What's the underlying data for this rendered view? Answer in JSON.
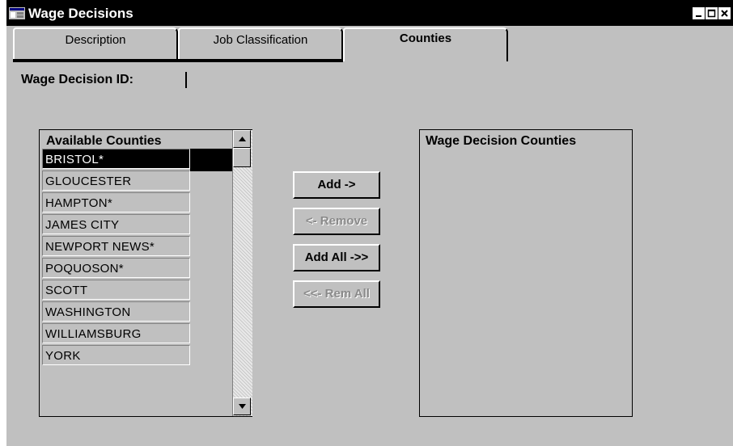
{
  "window": {
    "title": "Wage Decisions"
  },
  "tabs": [
    {
      "label": "Description",
      "active": false
    },
    {
      "label": "Job Classification",
      "active": false
    },
    {
      "label": "Counties",
      "active": true
    }
  ],
  "form": {
    "wage_decision_id_label": "Wage Decision ID:",
    "wage_decision_id_value": ""
  },
  "available_counties": {
    "header": "Available Counties",
    "items": [
      {
        "label": "BRISTOL*",
        "selected": true
      },
      {
        "label": "GLOUCESTER",
        "selected": false
      },
      {
        "label": "HAMPTON*",
        "selected": false
      },
      {
        "label": "JAMES CITY",
        "selected": false
      },
      {
        "label": "NEWPORT NEWS*",
        "selected": false
      },
      {
        "label": "POQUOSON*",
        "selected": false
      },
      {
        "label": "SCOTT",
        "selected": false
      },
      {
        "label": "WASHINGTON",
        "selected": false
      },
      {
        "label": "WILLIAMSBURG",
        "selected": false
      },
      {
        "label": "YORK",
        "selected": false
      }
    ]
  },
  "actions": {
    "add": {
      "label": "Add ->",
      "enabled": true
    },
    "remove": {
      "label": "<- Remove",
      "enabled": false
    },
    "add_all": {
      "label": "Add All ->>",
      "enabled": true
    },
    "rem_all": {
      "label": "<<- Rem All",
      "enabled": false
    }
  },
  "wage_decision_counties": {
    "header": "Wage Decision Counties",
    "items": []
  },
  "colors": {
    "face": "#c0c0c0",
    "titlebar": "#000000",
    "selection": "#000000",
    "disabled_text": "#8a8a8a"
  },
  "icons": {
    "app": "app-window-icon",
    "minimize": "minimize-icon",
    "maximize": "maximize-icon",
    "close": "close-icon",
    "scroll_up": "scroll-up-arrow-icon",
    "scroll_down": "scroll-down-arrow-icon"
  }
}
